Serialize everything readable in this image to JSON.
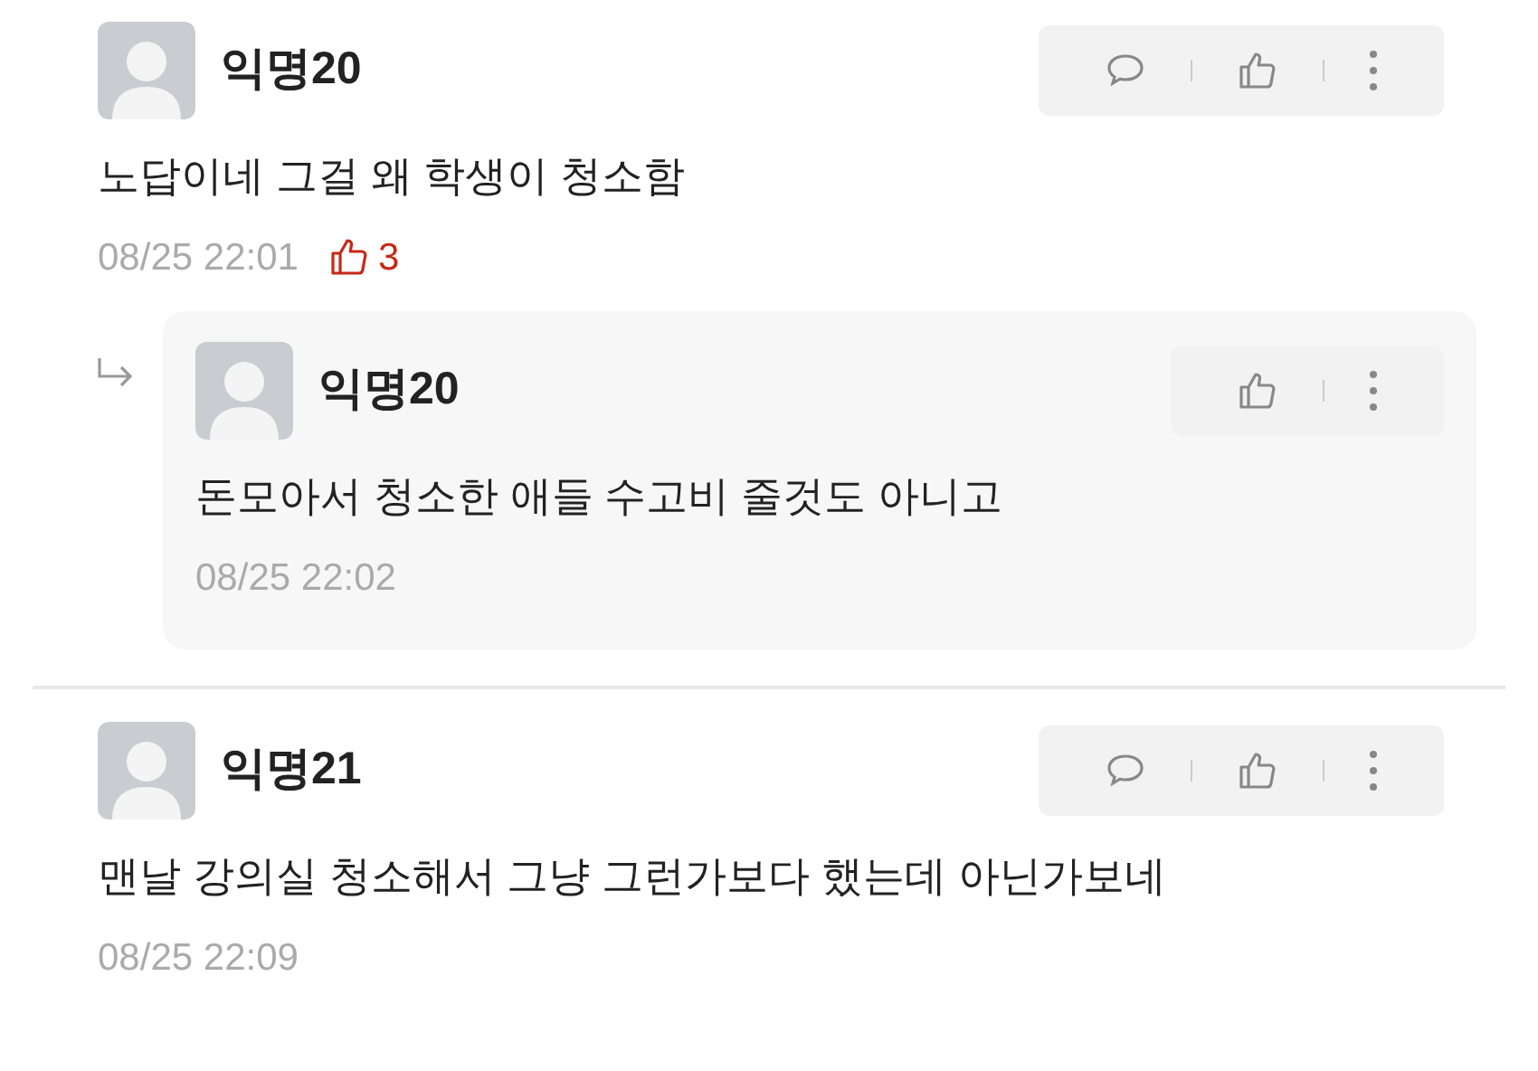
{
  "comments": [
    {
      "author": "익명20",
      "text": "노답이네 그걸 왜 학생이 청소함",
      "time": "08/25 22:01",
      "likes": "3",
      "reply_button": true,
      "replies": [
        {
          "author": "익명20",
          "text": "돈모아서 청소한 애들 수고비 줄것도 아니고",
          "time": "08/25 22:02",
          "reply_button": false
        }
      ]
    },
    {
      "author": "익명21",
      "text": "맨날 강의실 청소해서 그냥 그런가보다 했는데 아닌가보네",
      "time": "08/25 22:09",
      "reply_button": true
    }
  ]
}
